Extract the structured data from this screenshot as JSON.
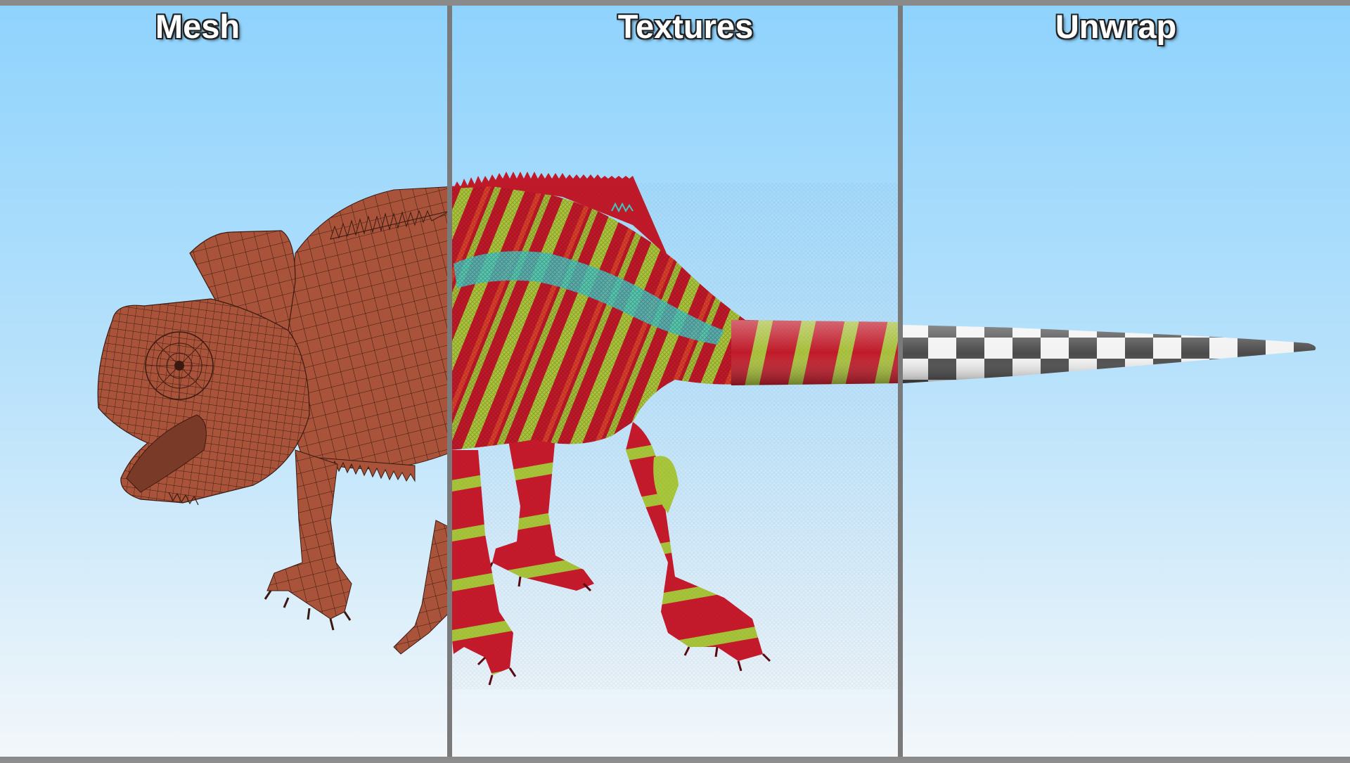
{
  "panels": [
    {
      "id": "mesh",
      "label": "Mesh"
    },
    {
      "id": "textures",
      "label": "Textures"
    },
    {
      "id": "unwrap",
      "label": "Unwrap"
    }
  ],
  "colors": {
    "sky_top": "#8fd3fd",
    "sky_bottom": "#f3f7fa",
    "divider": "#7a7a7a",
    "mesh_skin": "#a9543a",
    "mesh_wire": "#3a1a10",
    "texture_red": "#c01a2a",
    "texture_green": "#a8c83c",
    "texture_cyan": "#43c9c4",
    "checker_dark": "#4a4a4a",
    "checker_light": "#f2f2f2"
  }
}
